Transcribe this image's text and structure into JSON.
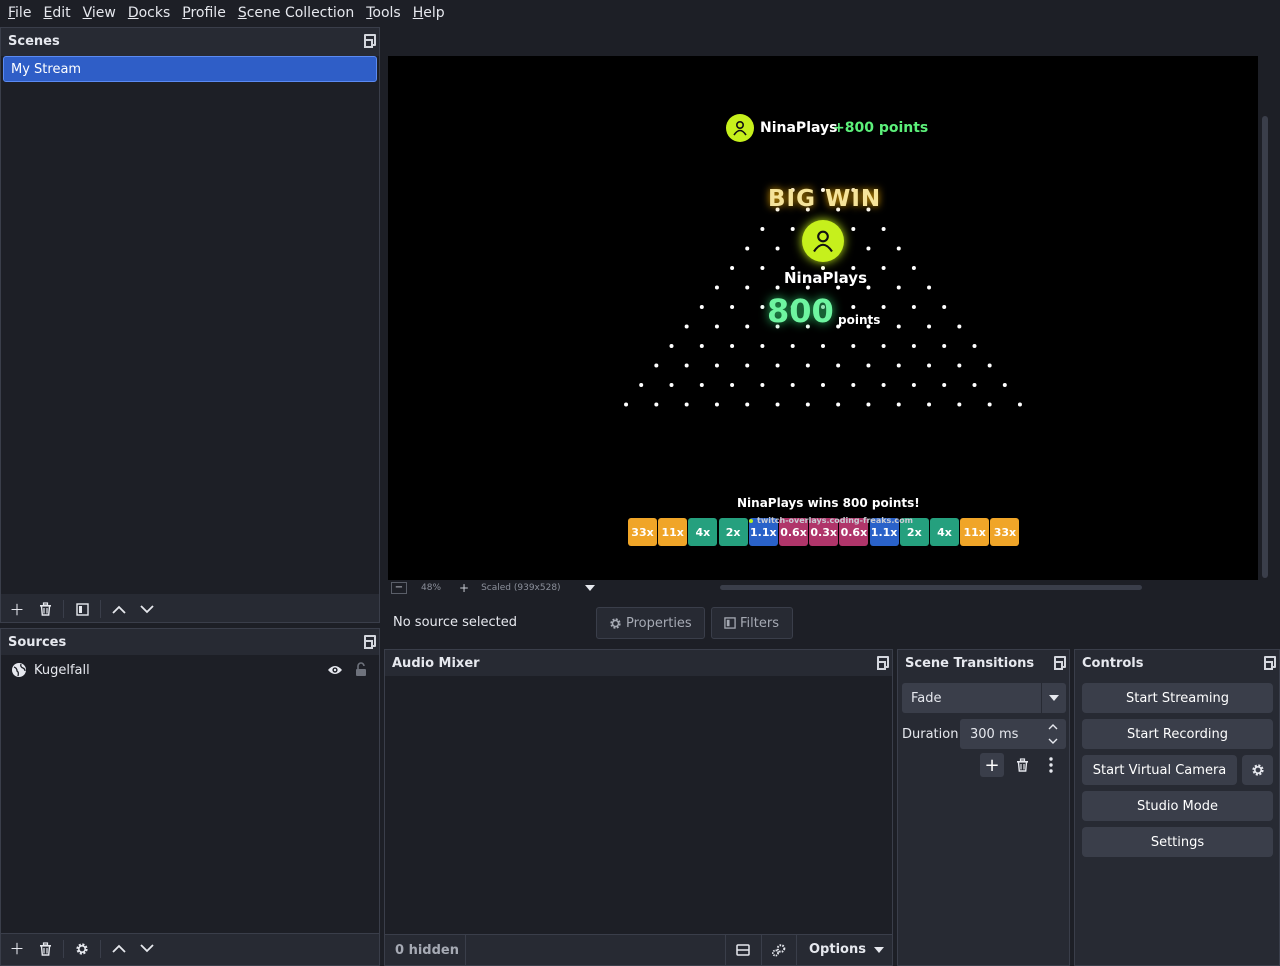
{
  "menubar": [
    "File",
    "Edit",
    "View",
    "Docks",
    "Profile",
    "Scene Collection",
    "Tools",
    "Help"
  ],
  "scenes": {
    "title": "Scenes",
    "items": [
      "My Stream"
    ]
  },
  "sources": {
    "title": "Sources",
    "items": [
      "Kugelfall"
    ]
  },
  "preview": {
    "zoom": "48%",
    "scale_label": "Scaled (939x528)",
    "overlay": {
      "top_user": "NinaPlays",
      "top_points": "+800 points",
      "big_win": "BIG WIN",
      "winner": "NinaPlays",
      "amount": "800",
      "amount_unit": "points",
      "result_text": "NinaPlays wins 800 points!",
      "footer": "twitch-overlays.coding-freaks.com",
      "slots": [
        "33x",
        "11x",
        "4x",
        "2x",
        "1.1x",
        "0.6x",
        "0.3x",
        "0.6x",
        "1.1x",
        "2x",
        "4x",
        "11x",
        "33x"
      ],
      "slot_colors": [
        "#f0a528",
        "#f0a528",
        "#25a07e",
        "#25a07e",
        "#2a62c9",
        "#b0356a",
        "#b0356a",
        "#b0356a",
        "#2a62c9",
        "#25a07e",
        "#25a07e",
        "#f0a528",
        "#f0a528"
      ]
    }
  },
  "context": {
    "status": "No source selected",
    "properties": "Properties",
    "filters": "Filters"
  },
  "audio_mixer": {
    "title": "Audio Mixer",
    "hidden": "0 hidden",
    "options": "Options"
  },
  "transitions": {
    "title": "Scene Transitions",
    "selected": "Fade",
    "duration_label": "Duration",
    "duration_value": "300 ms"
  },
  "controls": {
    "title": "Controls",
    "start_streaming": "Start Streaming",
    "start_recording": "Start Recording",
    "start_virtual_camera": "Start Virtual Camera",
    "studio_mode": "Studio Mode",
    "settings": "Settings"
  }
}
